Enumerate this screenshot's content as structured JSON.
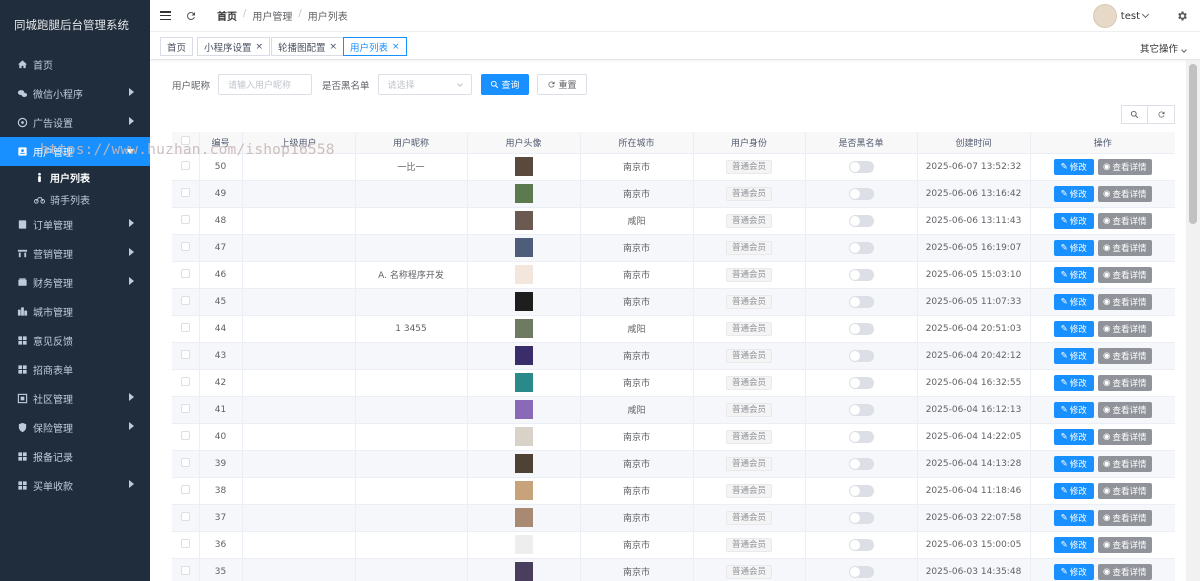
{
  "app": {
    "title": "同城跑腿后台管理系统",
    "watermark": "https://www.huzhan.com/ishop16558"
  },
  "sidebar": {
    "items": [
      {
        "label": "首页",
        "icon": "home-icon",
        "has_children": false
      },
      {
        "label": "微信小程序",
        "icon": "wechat-icon",
        "has_children": true
      },
      {
        "label": "广告设置",
        "icon": "ad-icon",
        "has_children": true
      },
      {
        "label": "用户管理",
        "icon": "user-card-icon",
        "has_children": true,
        "active": true
      },
      {
        "label": "订单管理",
        "icon": "order-icon",
        "has_children": true
      },
      {
        "label": "营销管理",
        "icon": "marketing-icon",
        "has_children": true
      },
      {
        "label": "财务管理",
        "icon": "finance-icon",
        "has_children": true
      },
      {
        "label": "城市管理",
        "icon": "city-icon",
        "has_children": false
      },
      {
        "label": "意见反馈",
        "icon": "feedback-icon",
        "has_children": false
      },
      {
        "label": "招商表单",
        "icon": "form-icon",
        "has_children": false
      },
      {
        "label": "社区管理",
        "icon": "community-icon",
        "has_children": true
      },
      {
        "label": "保险管理",
        "icon": "insurance-icon",
        "has_children": true
      },
      {
        "label": "报备记录",
        "icon": "record-icon",
        "has_children": false
      },
      {
        "label": "买单收款",
        "icon": "payment-icon",
        "has_children": true
      }
    ],
    "sub_items": [
      {
        "label": "用户列表",
        "icon": "person-icon",
        "active": true
      },
      {
        "label": "骑手列表",
        "icon": "bike-icon",
        "active": false
      }
    ]
  },
  "header": {
    "breadcrumb": [
      "首页",
      "用户管理",
      "用户列表"
    ],
    "username": "test"
  },
  "tags": {
    "items": [
      "首页",
      "小程序设置",
      "轮播图配置",
      "用户列表"
    ],
    "active_index": 3,
    "more_label": "其它操作"
  },
  "search": {
    "nickname_label": "用户昵称",
    "nickname_placeholder": "请输入用户昵称",
    "blacklist_label": "是否黑名单",
    "blacklist_placeholder": "请选择",
    "query_label": "查询",
    "reset_label": "重置"
  },
  "table": {
    "columns": [
      "编号",
      "上级用户",
      "用户昵称",
      "用户头像",
      "所在城市",
      "用户身份",
      "是否黑名单",
      "创建时间",
      "操作"
    ],
    "edit_label": "修改",
    "view_label": "查看详情",
    "rows": [
      {
        "id": "50",
        "parent": "",
        "nickname": "一比一",
        "avatar_color": "#5a4a3e",
        "city": "南京市",
        "role": "普通会员",
        "created": "2025-06-07 13:52:32"
      },
      {
        "id": "49",
        "parent": "",
        "nickname": "",
        "avatar_color": "#5d7a4e",
        "city": "南京市",
        "role": "普通会员",
        "created": "2025-06-06 13:16:42"
      },
      {
        "id": "48",
        "parent": "",
        "nickname": "",
        "avatar_color": "#6a5a52",
        "city": "咸阳",
        "role": "普通会员",
        "created": "2025-06-06 13:11:43"
      },
      {
        "id": "47",
        "parent": "",
        "nickname": "",
        "avatar_color": "#4e5e7a",
        "city": "南京市",
        "role": "普通会员",
        "created": "2025-06-05 16:19:07"
      },
      {
        "id": "46",
        "parent": "",
        "nickname": "A. 名称程序开发",
        "avatar_color": "#f3e6dc",
        "city": "南京市",
        "role": "普通会员",
        "created": "2025-06-05 15:03:10"
      },
      {
        "id": "45",
        "parent": "",
        "nickname": "",
        "avatar_color": "#1e1e1e",
        "city": "南京市",
        "role": "普通会员",
        "created": "2025-06-05 11:07:33"
      },
      {
        "id": "44",
        "parent": "",
        "nickname": "1 3455",
        "avatar_color": "#6e7a62",
        "city": "咸阳",
        "role": "普通会员",
        "created": "2025-06-04 20:51:03"
      },
      {
        "id": "43",
        "parent": "",
        "nickname": "",
        "avatar_color": "#3a2e6a",
        "city": "南京市",
        "role": "普通会员",
        "created": "2025-06-04 20:42:12"
      },
      {
        "id": "42",
        "parent": "",
        "nickname": "",
        "avatar_color": "#2a8a8a",
        "city": "南京市",
        "role": "普通会员",
        "created": "2025-06-04 16:32:55"
      },
      {
        "id": "41",
        "parent": "",
        "nickname": "",
        "avatar_color": "#8a6ab8",
        "city": "咸阳",
        "role": "普通会员",
        "created": "2025-06-04 16:12:13"
      },
      {
        "id": "40",
        "parent": "",
        "nickname": "",
        "avatar_color": "#d8d2c8",
        "city": "南京市",
        "role": "普通会员",
        "created": "2025-06-04 14:22:05"
      },
      {
        "id": "39",
        "parent": "",
        "nickname": "",
        "avatar_color": "#4e4234",
        "city": "南京市",
        "role": "普通会员",
        "created": "2025-06-04 14:13:28"
      },
      {
        "id": "38",
        "parent": "",
        "nickname": "",
        "avatar_color": "#c8a27a",
        "city": "南京市",
        "role": "普通会员",
        "created": "2025-06-04 11:18:46"
      },
      {
        "id": "37",
        "parent": "",
        "nickname": "",
        "avatar_color": "#a88a72",
        "city": "南京市",
        "role": "普通会员",
        "created": "2025-06-03 22:07:58"
      },
      {
        "id": "36",
        "parent": "",
        "nickname": "",
        "avatar_color": "#eeeeee",
        "city": "南京市",
        "role": "普通会员",
        "created": "2025-06-03 15:00:05"
      },
      {
        "id": "35",
        "parent": "",
        "nickname": "",
        "avatar_color": "#4a3e5e",
        "city": "南京市",
        "role": "普通会员",
        "created": "2025-06-03 14:35:48"
      }
    ]
  },
  "colors": {
    "sidebar_bg": "#1f2d3d",
    "accent": "#1890ff",
    "info_button": "#909399"
  }
}
